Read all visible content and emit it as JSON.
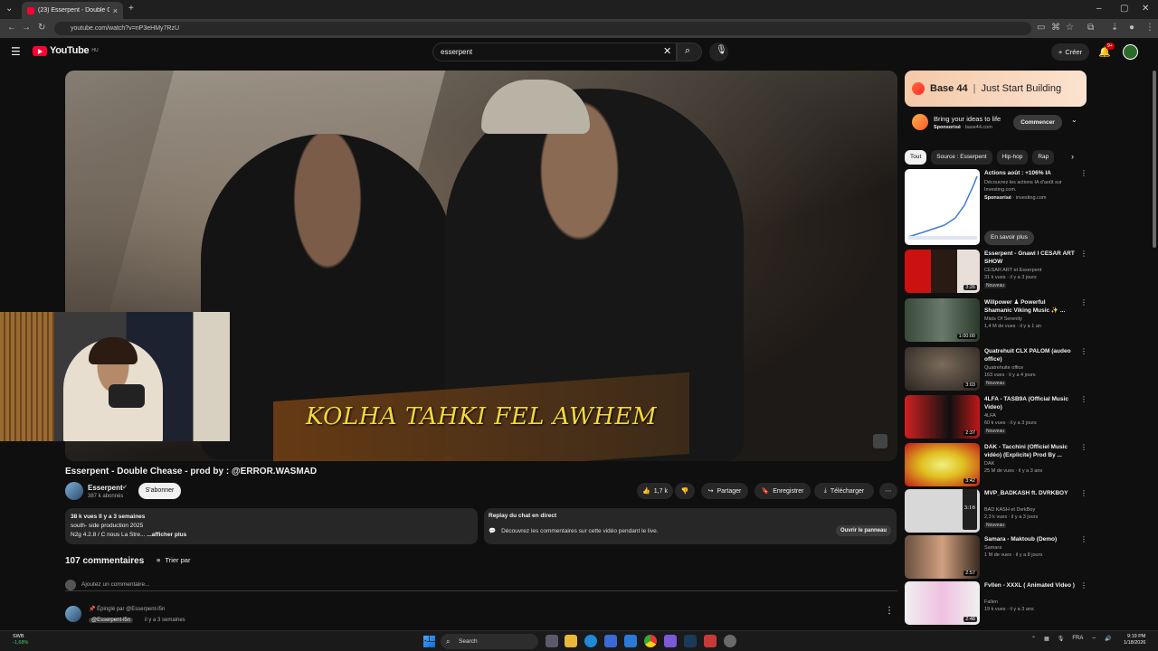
{
  "browser": {
    "tab_title": "(23) Esserpent - Double Ch...",
    "url": "youtube.com/watch?v=nP3eHMy7RzU"
  },
  "header": {
    "logo_text": "YouTube",
    "logo_sup": "HU",
    "search_value": "esserpent",
    "create_label": "Créer",
    "notif_count": "9+"
  },
  "video": {
    "subtitle": "KOLHA TAHKI FEL AWHEM",
    "title": "Esserpent - Double Chease - prod by : @ERROR.WASMAD",
    "channel": "Esserpent",
    "subs": "387 k abonnés",
    "subscribe_label": "S'abonner",
    "likes": "1,7 k",
    "share_label": "Partager",
    "save_label": "Enregistrer",
    "download_label": "Télécharger"
  },
  "description": {
    "line1": "38 k vues  Il y a 3 semaines",
    "line2": "south- side production  2025",
    "line3": "N2g 4.2.8 / C nous La Stre...",
    "more": "...afficher plus"
  },
  "chat": {
    "heading": "Replay du chat en direct",
    "text": "Découvrez les commentaires sur cette vidéo pendant le live.",
    "open_label": "Ouvrir le panneau"
  },
  "comments": {
    "count": "107 commentaires",
    "sort_label": "Trier par",
    "add_placeholder": "Ajoutez un commentaire...",
    "pinned_by": "Épinglé par @Esserpent-l5n",
    "first_author": "@Esserpent-l5n",
    "first_time": "il y a 3 semaines"
  },
  "ad": {
    "banner_brand": "Base 44",
    "banner_sep": "|",
    "banner_tagline": "Just Start Building",
    "info_title": "Bring your ideas to life",
    "sponsored": "Sponsorisé",
    "domain": "· base44.com",
    "cta": "Commencer"
  },
  "chips": [
    "Tout",
    "Source : Esserpent",
    "Hip-hop",
    "Rap"
  ],
  "sidebar_ad": {
    "title": "Actions août : +106% IA",
    "desc": "Découvrez les actions IA d'août sur Investing.com.",
    "sponsored": "Sponsorisé",
    "domain": "· investing.com",
    "cta": "En savoir plus"
  },
  "recommendations": [
    {
      "title": "Esserpent - Gnawi l CESAR ART SHOW",
      "channel": "CESAR ART et Esserpent",
      "meta": "31 k vues · il y a 3 jours",
      "badge": "Nouveau",
      "duration": "3:26"
    },
    {
      "title": "Willpower ♟ Powerful Shamanic Viking Music ✨ ...",
      "channel": "Mists Of Serenity",
      "meta": "1,4 M de vues · il y a 1 an",
      "badge": "",
      "duration": "1:00:00"
    },
    {
      "title": "Quatrehuit CLX PALOM (audeo office)",
      "channel": "Quatrehuite office",
      "meta": "163 vues · il y a 4 jours",
      "badge": "Nouveau",
      "duration": "3:03"
    },
    {
      "title": "4LFA - TASB9A (Official Music Video)",
      "channel": "4LFA",
      "meta": "60 k vues · il y a 3 jours",
      "badge": "Nouveau",
      "duration": "2:37"
    },
    {
      "title": "DAK - Tacchini (Officiel Music vidéo) (Explicite) Prod By ...",
      "channel": "DAK",
      "meta": "25 M de vues · il y a 3 ans",
      "badge": "",
      "duration": "3:42"
    },
    {
      "title": "MVP_BADKASH ft. DVRKBOY",
      "channel": "BAD KASH et DvrkBoy",
      "meta": "2,3 k vues · il y a 3 jours",
      "badge": "Nouveau",
      "duration": "3:16"
    },
    {
      "title": "Samara - Maktoub (Demo)",
      "channel": "Samara",
      "meta": "1 M de vues · il y a 8 jours",
      "badge": "",
      "duration": "2:57"
    },
    {
      "title": "Fvllen - XXXL ( Animated Video )",
      "channel": "Fallen",
      "meta": "19 k vues · il y a 3 ans",
      "badge": "",
      "duration": "2:48"
    }
  ],
  "taskbar": {
    "weather_temp": "SWB",
    "weather_change": "-1,68%",
    "search_label": "Search",
    "lang": "FRA",
    "time": "9:19 PM",
    "date": "1/18/2026"
  },
  "colors": {
    "accent_red": "#ff0033",
    "background": "#0f0f0f",
    "subtitle_yellow": "#f2d93a"
  }
}
